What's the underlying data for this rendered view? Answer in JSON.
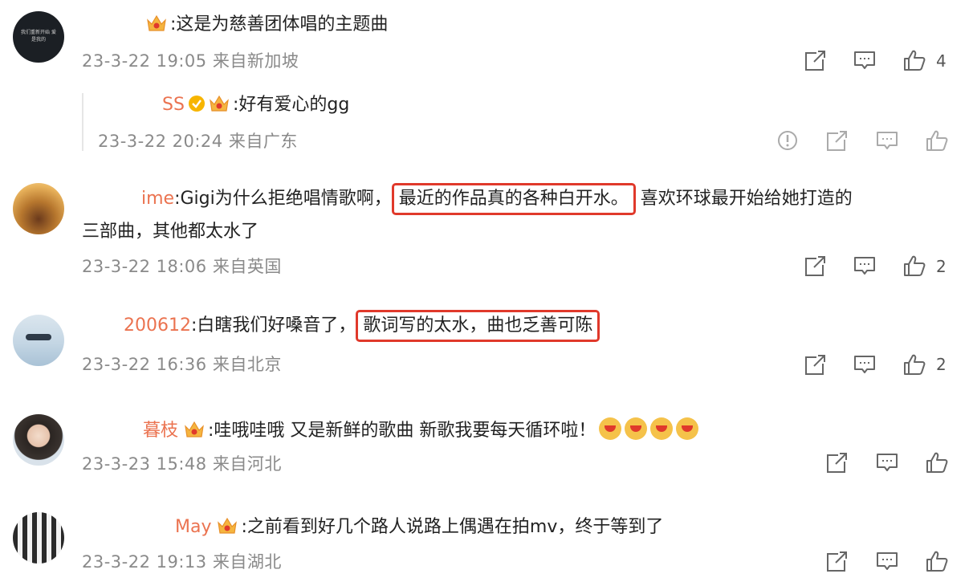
{
  "comments": [
    {
      "name": "",
      "text": ":这是为慈善团体唱的主题曲",
      "time": "23-3-22 19:05 来自新加坡",
      "likes": "4",
      "avatar_text": "我们重新开始 爱是我的"
    },
    {
      "name": "SS",
      "text": ":好有爱心的gg",
      "time": "23-3-22 20:24 来自广东",
      "likes": ""
    },
    {
      "name": "ime",
      "text_before": ":Gigi为什么拒绝唱情歌啊，",
      "highlight": "最近的作品真的各种白开水。",
      "text_after": "喜欢环球最开始给她打造的",
      "line2": "三部曲，其他都太水了",
      "time": "23-3-22 18:06 来自英国",
      "likes": "2"
    },
    {
      "name": "200612",
      "text_before": ":白瞎我们好嗓音了，",
      "highlight": "歌词写的太水，曲也乏善可陈",
      "time": "23-3-22 16:36 来自北京",
      "likes": "2"
    },
    {
      "name": "暮枝",
      "text": ":哇哦哇哦  又是新鲜的歌曲  新歌我要每天循环啦！",
      "time": "23-3-23 15:48 来自河北",
      "likes": ""
    },
    {
      "name": "May",
      "text": ":之前看到好几个路人说路上偶遇在拍mv，终于等到了",
      "time": "23-3-22 19:13 来自湖北",
      "likes": ""
    }
  ],
  "colors": {
    "username": "#eb7350",
    "highlight_border": "#e0392b",
    "meta": "#8a8a8a"
  },
  "icons": [
    "share-icon",
    "comment-icon",
    "like-icon",
    "report-icon",
    "crown-badge-icon",
    "verified-icon",
    "grin-emoji-icon"
  ]
}
